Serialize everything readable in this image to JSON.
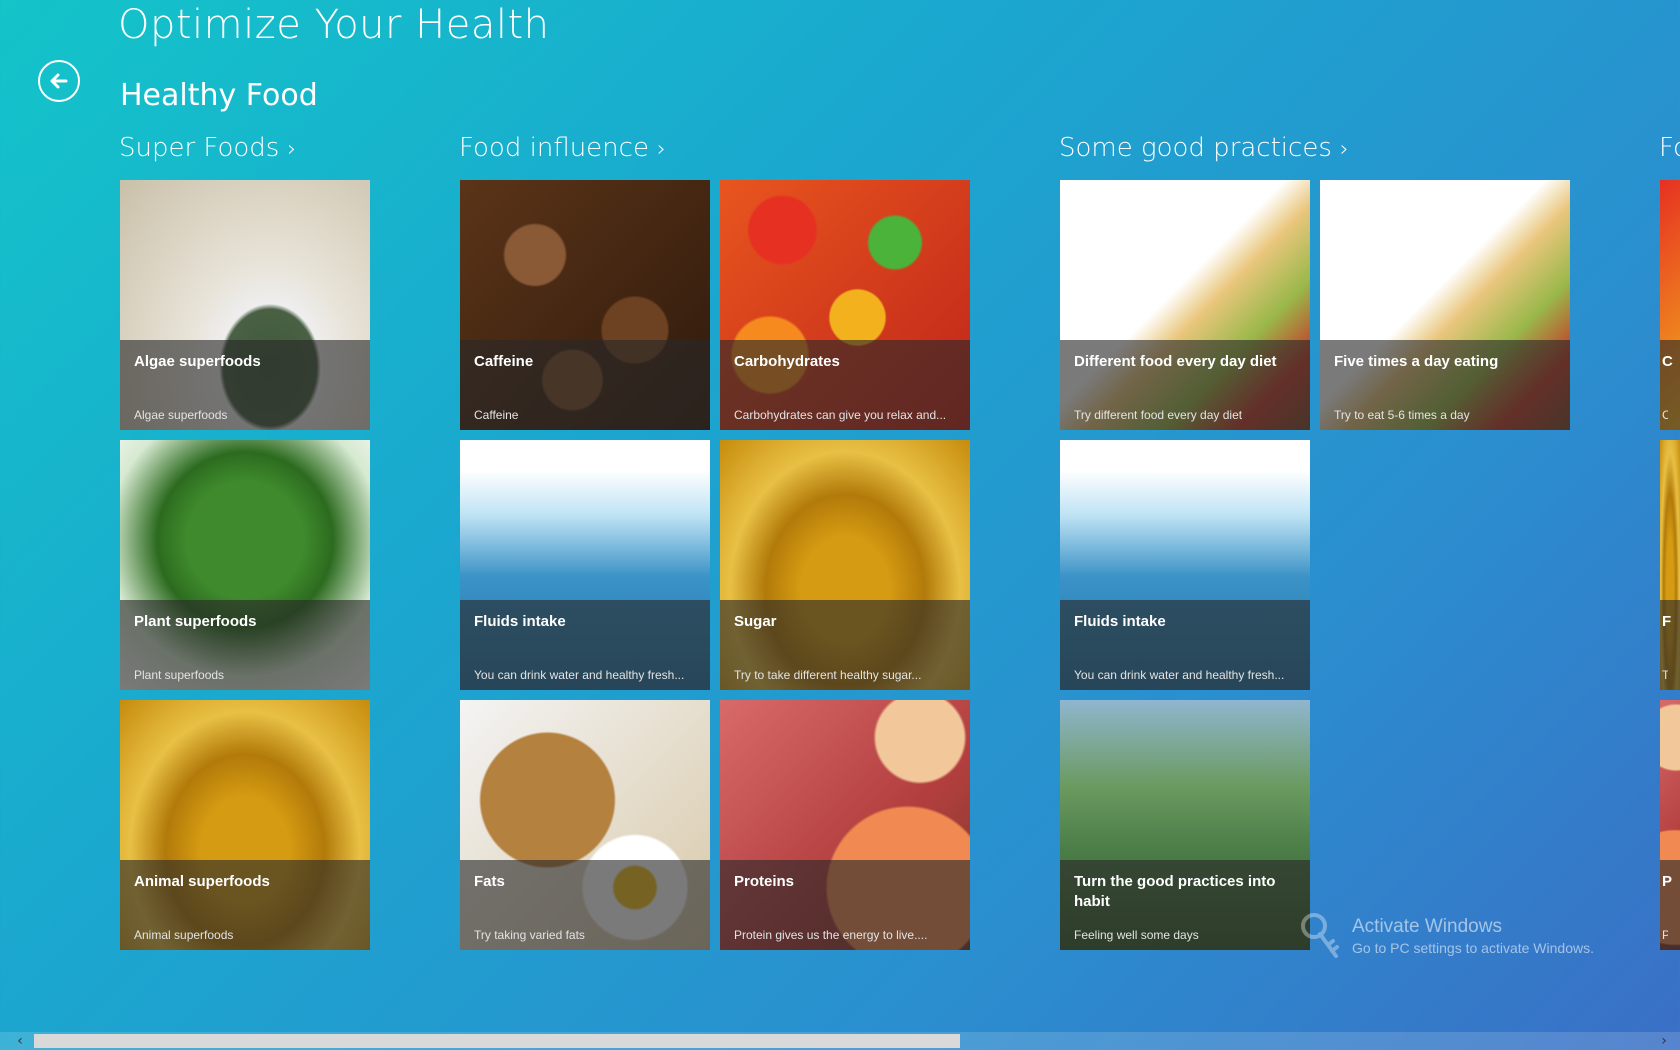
{
  "app": {
    "title": "Optimize Your Health"
  },
  "page": {
    "title": "Healthy Food"
  },
  "groups": [
    {
      "header": "Super Foods",
      "items": [
        {
          "title": "Algae superfoods",
          "subtitle": "Algae superfoods",
          "image": "algae"
        },
        {
          "title": "Plant superfoods",
          "subtitle": "Plant superfoods",
          "image": "greens"
        },
        {
          "title": "Animal superfoods",
          "subtitle": "Animal superfoods",
          "image": "honey"
        }
      ]
    },
    {
      "header": "Food influence",
      "items": [
        {
          "title": "Caffeine",
          "subtitle": "Caffeine",
          "image": "coffee"
        },
        {
          "title": "Carbohydrates",
          "subtitle": "Carbohydrates can give you relax and...",
          "image": "gummy"
        },
        {
          "title": "Fluids intake",
          "subtitle": "You can drink water and healthy fresh...",
          "image": "water"
        },
        {
          "title": "Sugar",
          "subtitle": "Try to take different healthy sugar...",
          "image": "honey"
        },
        {
          "title": "Fats",
          "subtitle": "Try taking varied fats",
          "image": "breakfast"
        },
        {
          "title": "Proteins",
          "subtitle": "Protein gives us the energy to live....",
          "image": "meat"
        }
      ]
    },
    {
      "header": "Some good practices",
      "items": [
        {
          "title": "Different food every day diet",
          "subtitle": "Try different food every day diet",
          "image": "pyramid"
        },
        {
          "title": "Five times a day eating",
          "subtitle": "Try to eat 5-6 times a day",
          "image": "pyramid"
        },
        {
          "title": "Fluids intake",
          "subtitle": "You can drink water and healthy fresh...",
          "image": "water"
        },
        {
          "title": "Turn the good practices into habit",
          "subtitle": "Feeling well some days",
          "image": "mountain"
        }
      ]
    },
    {
      "header": "Fo",
      "items": [
        {
          "title": "C",
          "subtitle": "C"
        },
        {
          "title": "F",
          "subtitle": "T"
        },
        {
          "title": "P",
          "subtitle": "P"
        }
      ]
    }
  ],
  "watermark": {
    "line1": "Activate Windows",
    "line2": "Go to PC settings to activate Windows."
  },
  "icons": {
    "back": "back-arrow-icon",
    "chevron": "chevron-right-icon",
    "key": "key-icon"
  }
}
